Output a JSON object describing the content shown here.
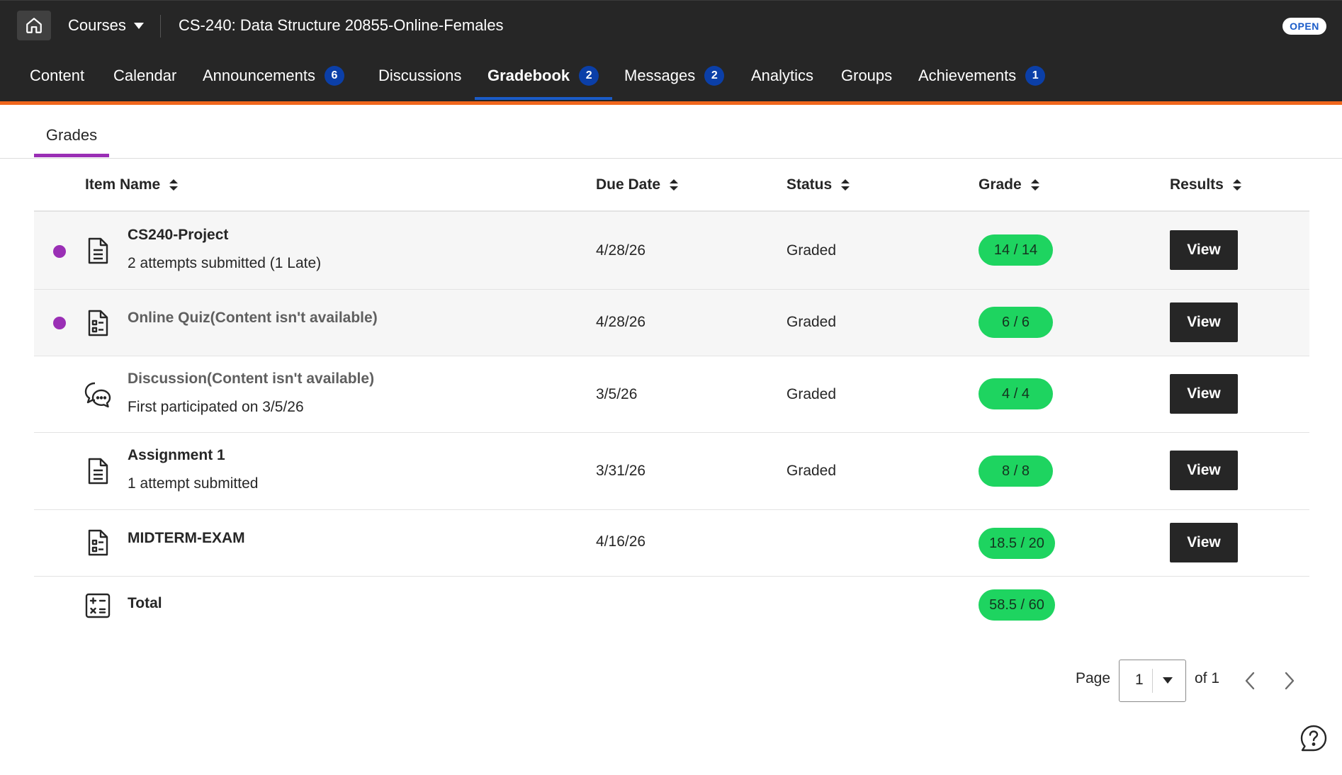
{
  "topbar": {
    "courses_label": "Courses",
    "course_title": "CS-240: Data Structure 20855-Online-Females",
    "open_badge": "OPEN"
  },
  "nav": {
    "items": [
      {
        "label": "Content",
        "badge": ""
      },
      {
        "label": "Calendar",
        "badge": ""
      },
      {
        "label": "Announcements",
        "badge": "6"
      },
      {
        "label": "Discussions",
        "badge": ""
      },
      {
        "label": "Gradebook",
        "badge": "2"
      },
      {
        "label": "Messages",
        "badge": "2"
      },
      {
        "label": "Analytics",
        "badge": ""
      },
      {
        "label": "Groups",
        "badge": ""
      },
      {
        "label": "Achievements",
        "badge": "1"
      }
    ],
    "active": "Gradebook"
  },
  "subtabs": {
    "grades": "Grades"
  },
  "table": {
    "headers": {
      "item_name": "Item Name",
      "due_date": "Due Date",
      "status": "Status",
      "grade": "Grade",
      "results": "Results"
    },
    "rows": [
      {
        "title": "CS240-Project",
        "subtitle": "2 attempts submitted (1 Late)",
        "due": "4/28/26",
        "status": "Graded",
        "grade": "14 / 14",
        "view": "View",
        "icon": "document-icon",
        "new_indicator": true
      },
      {
        "title": "Online Quiz(Content isn't available)",
        "subtitle": "",
        "due": "4/28/26",
        "status": "Graded",
        "grade": "6 / 6",
        "view": "View",
        "icon": "quiz-icon",
        "new_indicator": true
      },
      {
        "title": "Discussion(Content isn't available)",
        "subtitle": "First participated on 3/5/26",
        "due": "3/5/26",
        "status": "Graded",
        "grade": "4 / 4",
        "view": "View",
        "icon": "discussion-icon",
        "new_indicator": false
      },
      {
        "title": "Assignment 1",
        "subtitle": "1 attempt submitted",
        "due": "3/31/26",
        "status": "Graded",
        "grade": "8 / 8",
        "view": "View",
        "icon": "document-icon",
        "new_indicator": false
      },
      {
        "title": "MIDTERM-EXAM",
        "subtitle": "",
        "due": "4/16/26",
        "status": "",
        "grade": "18.5 / 20",
        "view": "View",
        "icon": "quiz-icon",
        "new_indicator": false
      }
    ],
    "total": {
      "title": "Total",
      "grade": "58.5 / 60",
      "icon": "calculator-icon"
    }
  },
  "pagination": {
    "page_label": "Page",
    "current_page": "1",
    "of_label": "of 1"
  },
  "colors": {
    "topbar_bg": "#262626",
    "accent_orange": "#f0661c",
    "badge_blue": "#0b3fa8",
    "active_underline": "#1a5bc8",
    "subtab_purple": "#9a2fb5",
    "grade_green": "#1ed460"
  }
}
